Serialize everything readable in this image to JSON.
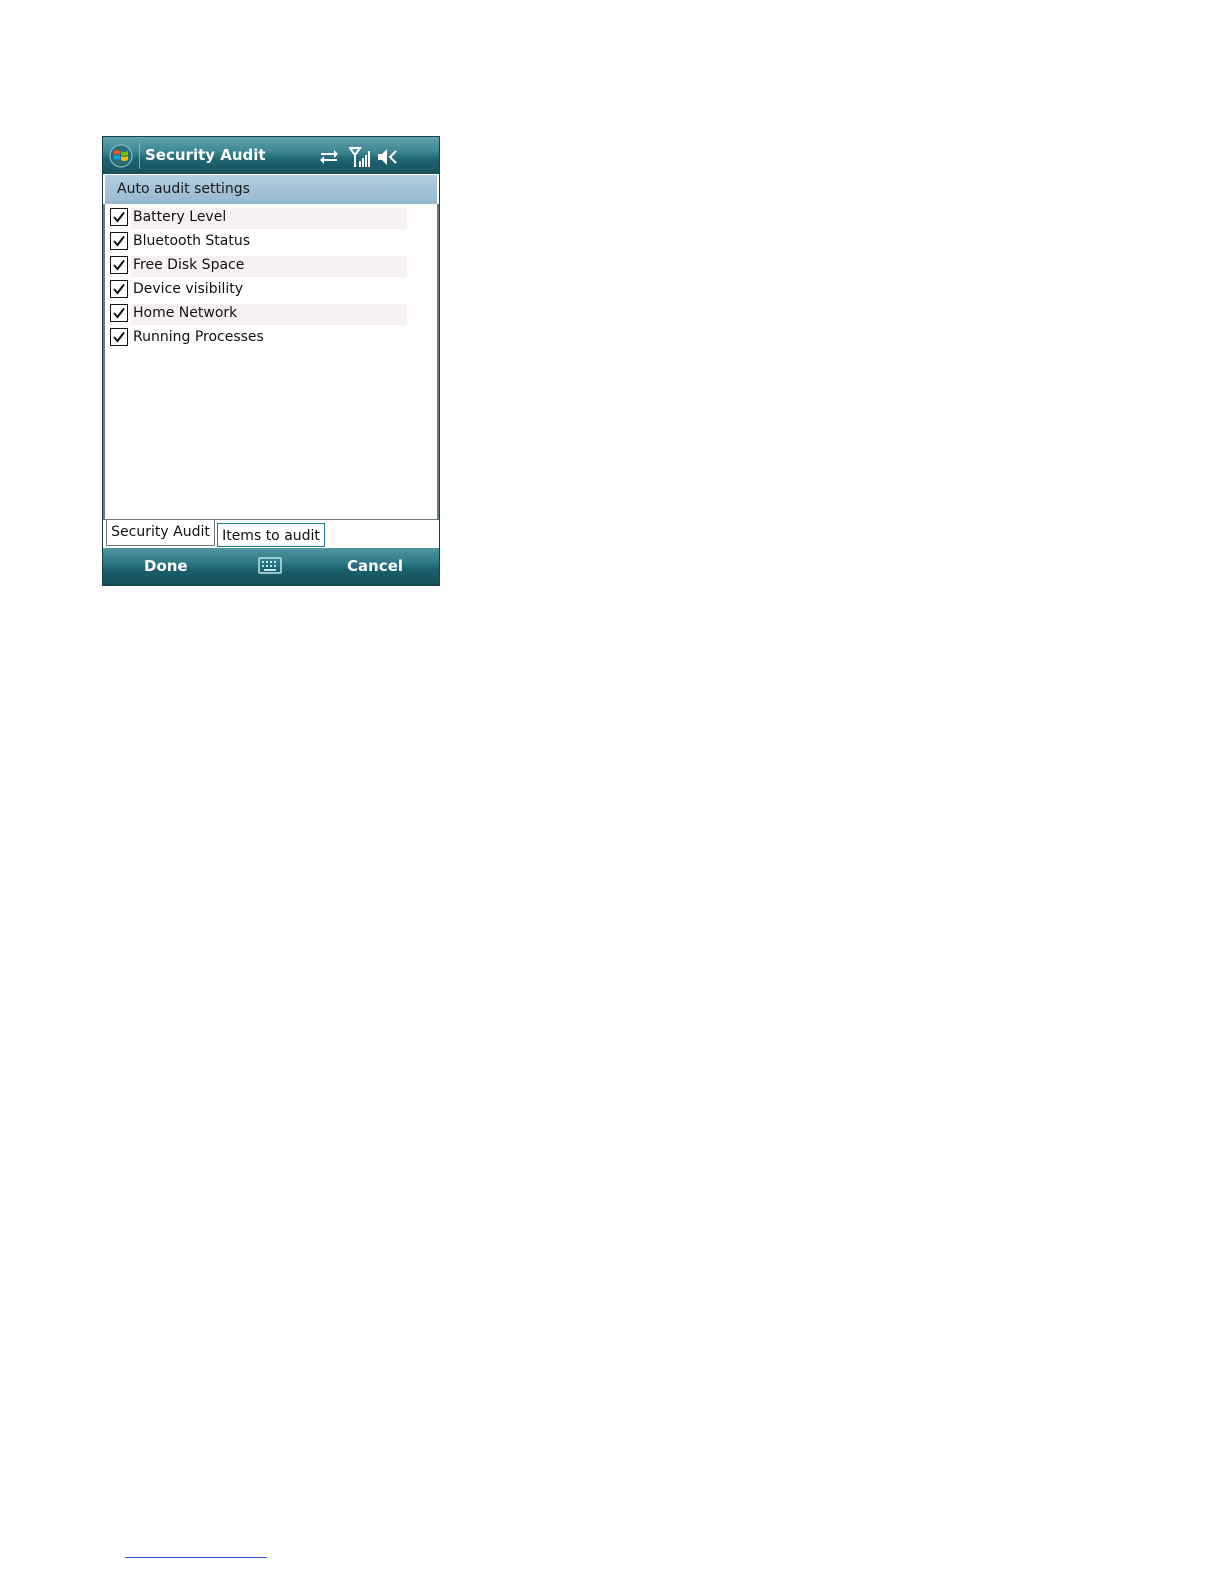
{
  "titlebar": {
    "title": "Security Audit",
    "icons": [
      "windows-start-icon",
      "connectivity-icon",
      "signal-strength-icon",
      "speaker-muted-icon"
    ]
  },
  "section_header": {
    "label": "Auto audit settings"
  },
  "audit_items": [
    {
      "label": "Battery Level",
      "checked": true
    },
    {
      "label": "Bluetooth Status",
      "checked": true
    },
    {
      "label": "Free Disk Space",
      "checked": true
    },
    {
      "label": "Device visibility",
      "checked": true
    },
    {
      "label": "Home Network",
      "checked": true
    },
    {
      "label": "Running Processes",
      "checked": true
    }
  ],
  "tabs": [
    {
      "label": "Security Audit",
      "selected": false
    },
    {
      "label": "Items to audit",
      "selected": true
    }
  ],
  "softkeys": {
    "left": "Done",
    "right": "Cancel",
    "center_icon": "keyboard-icon"
  },
  "colors": {
    "titlebar": "#2d7885",
    "header": "#a4c3d8",
    "row_shade": "#f8f1f4",
    "selected_tab_border": "#1d7b8a"
  }
}
